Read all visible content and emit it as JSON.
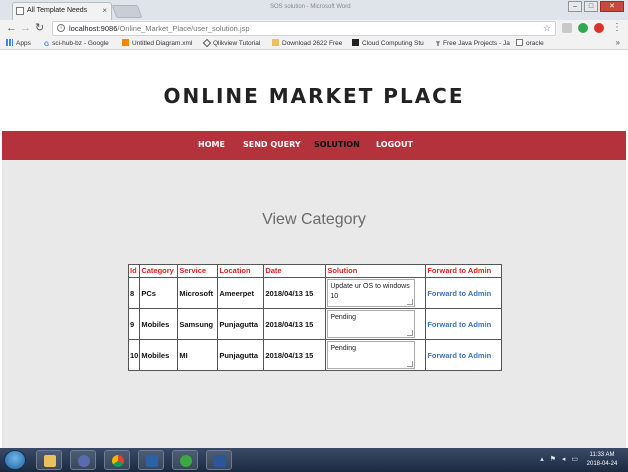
{
  "browser": {
    "tab_title": "All Template Needs",
    "tab_close": "×",
    "window_title": "SOS solution - Microsoft Word",
    "url_host": "localhost:9086",
    "url_path": "/Online_Market_Place/user_solution.jsp",
    "win_buttons": [
      "–",
      "□",
      "✕"
    ],
    "bookmarks": [
      "Apps",
      "sci-hub-bz - Google",
      "Untitled Diagram.xml",
      "Qlikview Tutorial",
      "Download 2622 Free",
      "Cloud Computing Stu",
      "Free Java Projects - Ja",
      "oracle"
    ],
    "bookmarks_more": "»"
  },
  "site": {
    "title": "ONLINE MARKET PLACE",
    "nav": [
      "HOME",
      "SEND QUERY",
      "SOLUTION",
      "LOGOUT"
    ],
    "active_nav": "SOLUTION",
    "brand_color": "#b3323c"
  },
  "page": {
    "heading": "View Category",
    "table": {
      "headers": [
        "Id",
        "Category",
        "Service",
        "Location",
        "Date",
        "Solution",
        "Forward to Admin"
      ],
      "rows": [
        {
          "id": "8",
          "category": "PCs",
          "service": "Microsoft",
          "location": "Ameerpet",
          "date": "2018/04/13 15",
          "solution": "Update ur OS to windows 10",
          "forward": "Forward to Admin"
        },
        {
          "id": "9",
          "category": "Mobiles",
          "service": "Samsung",
          "location": "Punjagutta",
          "date": "2018/04/13 15",
          "solution": "Pending",
          "forward": "Forward to Admin"
        },
        {
          "id": "10",
          "category": "Mobiles",
          "service": "MI",
          "location": "Punjagutta",
          "date": "2018/04/13 15",
          "solution": "Pending",
          "forward": "Forward to Admin"
        }
      ]
    }
  },
  "taskbar": {
    "time": "11:33 AM",
    "date": "2018-04-24"
  }
}
